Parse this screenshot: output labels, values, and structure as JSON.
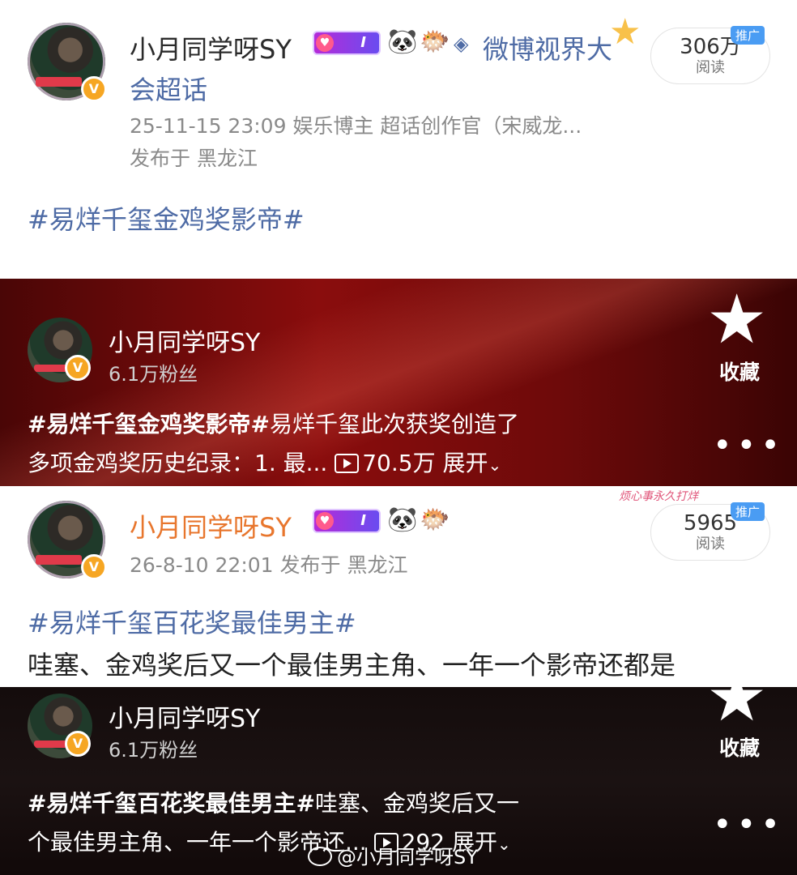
{
  "post1": {
    "username": "小月同学呀SY",
    "medal_level": "I",
    "emoji_1": "🐼",
    "emoji_2": "🐡",
    "badge_text": "微博视界大",
    "badge_text_2": "会超话",
    "meta_line": "25-11-15 23:09  娱乐博主 超话创作官（宋威龙...",
    "location": "发布于 黑龙江",
    "topic": "#易烊千玺金鸡奖影帝#",
    "reads_value": "306万",
    "reads_label": "阅读",
    "ad_label": "推广"
  },
  "video1": {
    "username": "小月同学呀SY",
    "fans": "6.1万粉丝",
    "text_bold": "#易烊千玺金鸡奖影帝#",
    "text_rest": "易烊千玺此次获奖创造了",
    "text_line2": "多项金鸡奖历史纪录：1. 最...",
    "plays": "70.5万",
    "expand": "展开",
    "collect": "收藏",
    "more": "•••"
  },
  "post2": {
    "username": "小月同学呀SY",
    "medal_level": "I",
    "emoji_1": "🐼",
    "emoji_2": "🐡",
    "banner": "烦心事永久打烊",
    "meta_line": "26-8-10 22:01  发布于 黑龙江",
    "topic": "#易烊千玺百花奖最佳男主#",
    "text": "哇塞、金鸡奖后又一个最佳男主角、一年一个影帝还都是",
    "reads_value": "5965",
    "reads_label": "阅读",
    "ad_label": "推广"
  },
  "video2": {
    "username": "小月同学呀SY",
    "fans": "6.1万粉丝",
    "text_bold": "#易烊千玺百花奖最佳男主#",
    "text_rest": "哇塞、金鸡奖后又一",
    "text_line2": "个最佳男主角、一年一个影帝还...",
    "plays": "292",
    "expand": "展开",
    "collect": "收藏",
    "more": "•••"
  },
  "watermark": "@小月同学呀SY"
}
